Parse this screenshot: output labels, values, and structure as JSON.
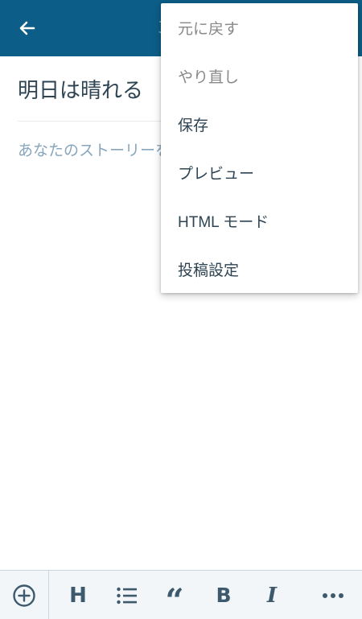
{
  "header": {
    "back_icon": "arrow-left-icon",
    "obscured_title_fragment": "3"
  },
  "editor": {
    "post_title": "明日は晴れる",
    "content_placeholder": "あなたのストーリーを書いてください..."
  },
  "menu": {
    "items": [
      {
        "label": "元に戻す",
        "enabled": false
      },
      {
        "label": "やり直し",
        "enabled": false
      },
      {
        "label": "保存",
        "enabled": true
      },
      {
        "label": "プレビュー",
        "enabled": true
      },
      {
        "label": "HTML モード",
        "enabled": true
      },
      {
        "label": "投稿設定",
        "enabled": true
      }
    ]
  },
  "toolbar": {
    "add_icon": "add-circle-icon",
    "heading_label": "H",
    "list_icon": "bulleted-list-icon",
    "quote_label": "“",
    "bold_label": "B",
    "italic_label": "I",
    "more_icon": "ellipsis-icon"
  },
  "colors": {
    "appbar": "#0c5d87",
    "title_text": "#2e4453",
    "placeholder_text": "#87a6bc",
    "toolbar_icons": "#3d596d",
    "toolbar_bg": "#f3f6f8"
  }
}
